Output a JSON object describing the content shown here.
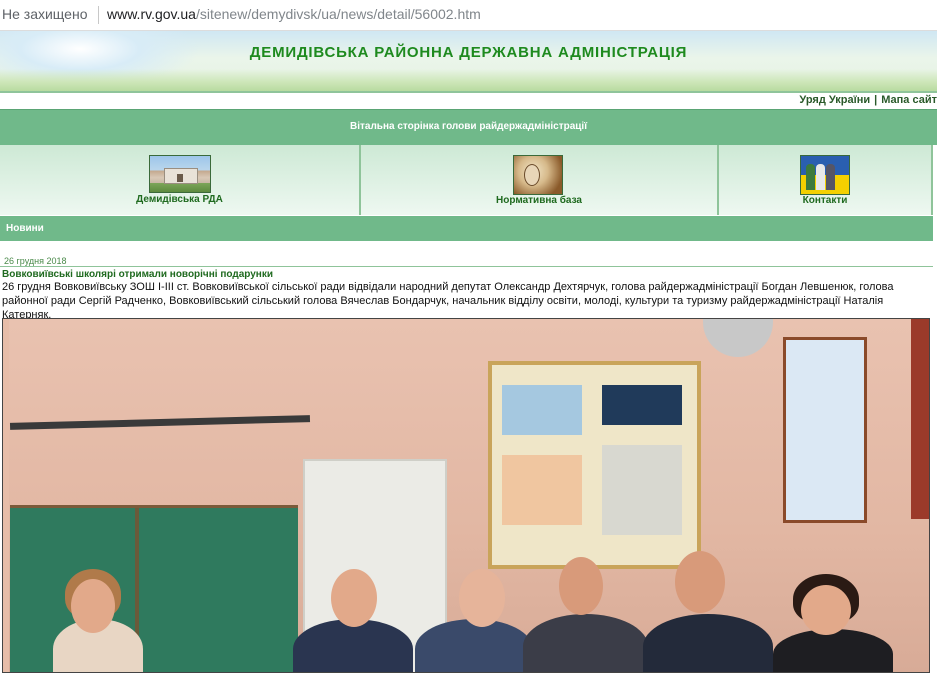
{
  "browser": {
    "security": "Не захищено",
    "url_host": "www.rv.gov.ua",
    "url_path": "/sitenew/demydivsk/ua/news/detail/56002.htm"
  },
  "header": {
    "title": "ДЕМИДІВСЬКА РАЙОННА ДЕРЖАВНА АДМІНІСТРАЦІЯ"
  },
  "top_links": [
    {
      "label": "Уряд України"
    },
    {
      "label": "Мапа сайт"
    }
  ],
  "nav": {
    "welcome_link": "Вітальна сторінка голови райдержадміністрації"
  },
  "icons": [
    {
      "label": "Демидівська РДА",
      "icon": "building-photo-icon"
    },
    {
      "label": "Нормативна база",
      "icon": "portrait-document-icon"
    },
    {
      "label": "Контакти",
      "icon": "people-flag-icon"
    }
  ],
  "section": {
    "title": "Новини"
  },
  "news": {
    "date": "26 грудня 2018",
    "headline": "Вовковиївські школярі отримали новорічні подарунки",
    "body": "26 грудня   Вовковиївську ЗОШ І-ІІІ ст. Вовковиївської сільської ради  відвідали народний депутат Олександр Дехтярчук, голова райдержадміністрації Богдан Левшенюк, голова районної ради Сергій Радченко, Вовковиївський сільський голова Вячеслав Бондарчук, начальник відділу освіти, молоді, культури та туризму райдержадміністрації Наталія Катерняк."
  },
  "colors": {
    "brand_green": "#1e8a1e",
    "nav_green": "#70b98a"
  }
}
